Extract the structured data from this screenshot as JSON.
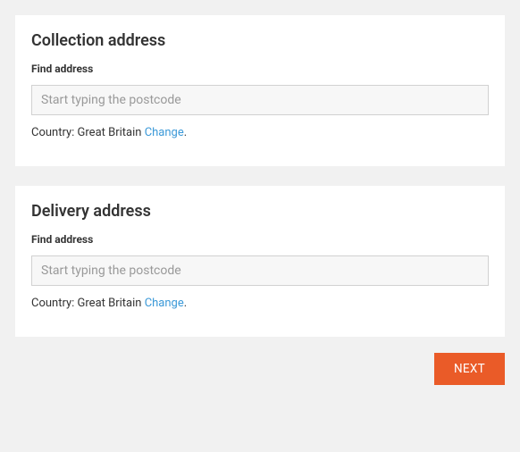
{
  "collection": {
    "title": "Collection address",
    "findLabel": "Find address",
    "placeholder": "Start typing the postcode",
    "countryPrefix": "Country: ",
    "countryName": "Great Britain",
    "changeLabel": "Change",
    "period": "."
  },
  "delivery": {
    "title": "Delivery address",
    "findLabel": "Find address",
    "placeholder": "Start typing the postcode",
    "countryPrefix": "Country: ",
    "countryName": "Great Britain",
    "changeLabel": "Change",
    "period": "."
  },
  "actions": {
    "nextLabel": "NEXT"
  }
}
